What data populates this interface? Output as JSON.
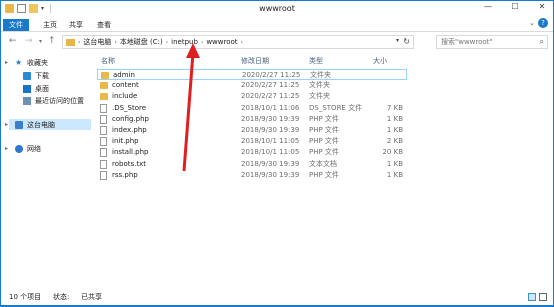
{
  "titlebar": {
    "title": "wwwroot",
    "controls": {
      "minimize": "—",
      "maximize": "☐",
      "close": "✕"
    }
  },
  "ribbon": {
    "tabs": [
      "文件",
      "主页",
      "共享",
      "查看"
    ],
    "active_tab": "文件",
    "accent": "#1979ca"
  },
  "nav": {
    "back": "←",
    "forward": "→",
    "up": "↑",
    "breadcrumb": [
      "这台电脑",
      "本地磁盘 (C:)",
      "inetpub",
      "wwwroot"
    ],
    "separator": "›",
    "search_placeholder": "搜索\"wwwroot\""
  },
  "navpane": {
    "favorites": "收藏夹",
    "items": [
      "下载",
      "桌面",
      "最近访问的位置"
    ],
    "pc": "这台电脑",
    "network": "网络"
  },
  "columns": {
    "name": "名称",
    "date": "修改日期",
    "type": "类型",
    "size": "大小"
  },
  "files": [
    {
      "name": "admin",
      "date": "2020/2/27 11:25",
      "type": "文件夹",
      "size": "",
      "kind": "folder"
    },
    {
      "name": "content",
      "date": "2020/2/27 11:25",
      "type": "文件夹",
      "size": "",
      "kind": "folder"
    },
    {
      "name": "include",
      "date": "2020/2/27 11:25",
      "type": "文件夹",
      "size": "",
      "kind": "folder"
    },
    {
      "name": ".DS_Store",
      "date": "2018/10/1 11:06",
      "type": "DS_STORE 文件",
      "size": "7 KB",
      "kind": "doc"
    },
    {
      "name": "config.php",
      "date": "2018/9/30 19:39",
      "type": "PHP 文件",
      "size": "1 KB",
      "kind": "doc"
    },
    {
      "name": "index.php",
      "date": "2018/9/30 19:39",
      "type": "PHP 文件",
      "size": "1 KB",
      "kind": "doc"
    },
    {
      "name": "init.php",
      "date": "2018/10/1 11:05",
      "type": "PHP 文件",
      "size": "2 KB",
      "kind": "doc"
    },
    {
      "name": "install.php",
      "date": "2018/10/1 11:05",
      "type": "PHP 文件",
      "size": "20 KB",
      "kind": "doc"
    },
    {
      "name": "robots.txt",
      "date": "2018/9/30 19:39",
      "type": "文本文档",
      "size": "1 KB",
      "kind": "doc"
    },
    {
      "name": "rss.php",
      "date": "2018/9/30 19:39",
      "type": "PHP 文件",
      "size": "1 KB",
      "kind": "doc"
    }
  ],
  "status": {
    "count": "10 个项目",
    "selected": "状态:",
    "shared": "已共享"
  },
  "annotation_color": "#e02020"
}
